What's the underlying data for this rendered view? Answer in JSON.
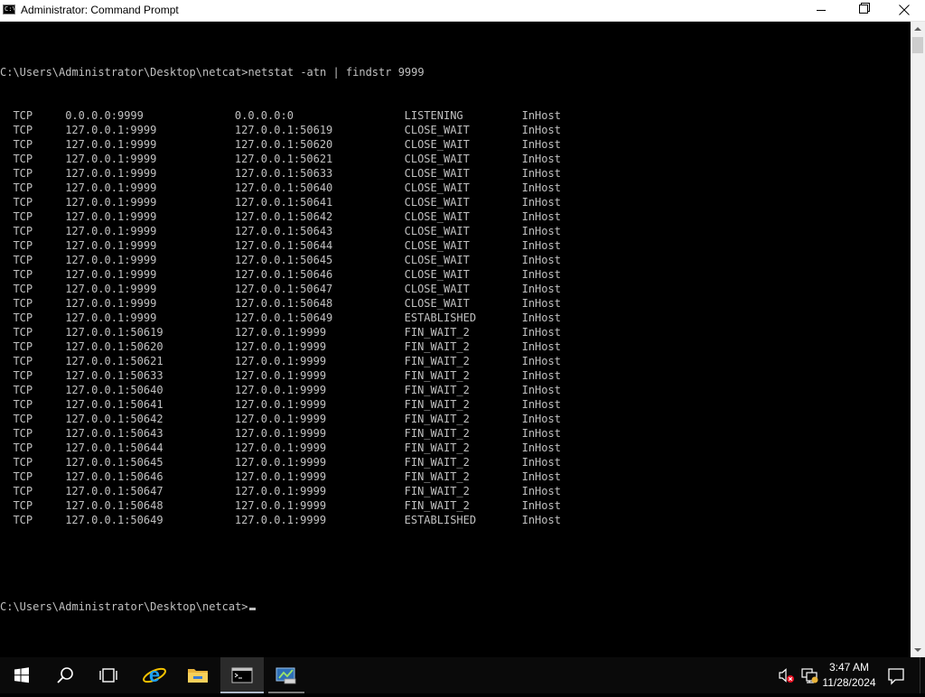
{
  "window": {
    "title": "Administrator: Command Prompt",
    "app_icon_text": "C:\\"
  },
  "console": {
    "command_line": "C:\\Users\\Administrator\\Desktop\\netcat>netstat -atn | findstr 9999",
    "rows": [
      [
        "TCP",
        "0.0.0.0:9999",
        "0.0.0.0:0",
        "LISTENING",
        "InHost"
      ],
      [
        "TCP",
        "127.0.0.1:9999",
        "127.0.0.1:50619",
        "CLOSE_WAIT",
        "InHost"
      ],
      [
        "TCP",
        "127.0.0.1:9999",
        "127.0.0.1:50620",
        "CLOSE_WAIT",
        "InHost"
      ],
      [
        "TCP",
        "127.0.0.1:9999",
        "127.0.0.1:50621",
        "CLOSE_WAIT",
        "InHost"
      ],
      [
        "TCP",
        "127.0.0.1:9999",
        "127.0.0.1:50633",
        "CLOSE_WAIT",
        "InHost"
      ],
      [
        "TCP",
        "127.0.0.1:9999",
        "127.0.0.1:50640",
        "CLOSE_WAIT",
        "InHost"
      ],
      [
        "TCP",
        "127.0.0.1:9999",
        "127.0.0.1:50641",
        "CLOSE_WAIT",
        "InHost"
      ],
      [
        "TCP",
        "127.0.0.1:9999",
        "127.0.0.1:50642",
        "CLOSE_WAIT",
        "InHost"
      ],
      [
        "TCP",
        "127.0.0.1:9999",
        "127.0.0.1:50643",
        "CLOSE_WAIT",
        "InHost"
      ],
      [
        "TCP",
        "127.0.0.1:9999",
        "127.0.0.1:50644",
        "CLOSE_WAIT",
        "InHost"
      ],
      [
        "TCP",
        "127.0.0.1:9999",
        "127.0.0.1:50645",
        "CLOSE_WAIT",
        "InHost"
      ],
      [
        "TCP",
        "127.0.0.1:9999",
        "127.0.0.1:50646",
        "CLOSE_WAIT",
        "InHost"
      ],
      [
        "TCP",
        "127.0.0.1:9999",
        "127.0.0.1:50647",
        "CLOSE_WAIT",
        "InHost"
      ],
      [
        "TCP",
        "127.0.0.1:9999",
        "127.0.0.1:50648",
        "CLOSE_WAIT",
        "InHost"
      ],
      [
        "TCP",
        "127.0.0.1:9999",
        "127.0.0.1:50649",
        "ESTABLISHED",
        "InHost"
      ],
      [
        "TCP",
        "127.0.0.1:50619",
        "127.0.0.1:9999",
        "FIN_WAIT_2",
        "InHost"
      ],
      [
        "TCP",
        "127.0.0.1:50620",
        "127.0.0.1:9999",
        "FIN_WAIT_2",
        "InHost"
      ],
      [
        "TCP",
        "127.0.0.1:50621",
        "127.0.0.1:9999",
        "FIN_WAIT_2",
        "InHost"
      ],
      [
        "TCP",
        "127.0.0.1:50633",
        "127.0.0.1:9999",
        "FIN_WAIT_2",
        "InHost"
      ],
      [
        "TCP",
        "127.0.0.1:50640",
        "127.0.0.1:9999",
        "FIN_WAIT_2",
        "InHost"
      ],
      [
        "TCP",
        "127.0.0.1:50641",
        "127.0.0.1:9999",
        "FIN_WAIT_2",
        "InHost"
      ],
      [
        "TCP",
        "127.0.0.1:50642",
        "127.0.0.1:9999",
        "FIN_WAIT_2",
        "InHost"
      ],
      [
        "TCP",
        "127.0.0.1:50643",
        "127.0.0.1:9999",
        "FIN_WAIT_2",
        "InHost"
      ],
      [
        "TCP",
        "127.0.0.1:50644",
        "127.0.0.1:9999",
        "FIN_WAIT_2",
        "InHost"
      ],
      [
        "TCP",
        "127.0.0.1:50645",
        "127.0.0.1:9999",
        "FIN_WAIT_2",
        "InHost"
      ],
      [
        "TCP",
        "127.0.0.1:50646",
        "127.0.0.1:9999",
        "FIN_WAIT_2",
        "InHost"
      ],
      [
        "TCP",
        "127.0.0.1:50647",
        "127.0.0.1:9999",
        "FIN_WAIT_2",
        "InHost"
      ],
      [
        "TCP",
        "127.0.0.1:50648",
        "127.0.0.1:9999",
        "FIN_WAIT_2",
        "InHost"
      ],
      [
        "TCP",
        "127.0.0.1:50649",
        "127.0.0.1:9999",
        "ESTABLISHED",
        "InHost"
      ]
    ],
    "prompt": "C:\\Users\\Administrator\\Desktop\\netcat>"
  },
  "taskbar": {
    "clock_time": "3:47 AM",
    "clock_date": "11/28/2024",
    "items": [
      "start-icon",
      "search-icon",
      "task-view-icon",
      "internet-explorer-icon",
      "file-explorer-icon",
      "command-prompt-icon",
      "server-manager-icon"
    ],
    "tray": [
      "speaker-muted-icon",
      "network-icon",
      "notifications-icon"
    ]
  },
  "colors": {
    "console_bg": "#000000",
    "console_fg": "#c0c0c0",
    "taskbar_bg": "#0a0a0a",
    "titlebar_bg": "#ffffff"
  }
}
